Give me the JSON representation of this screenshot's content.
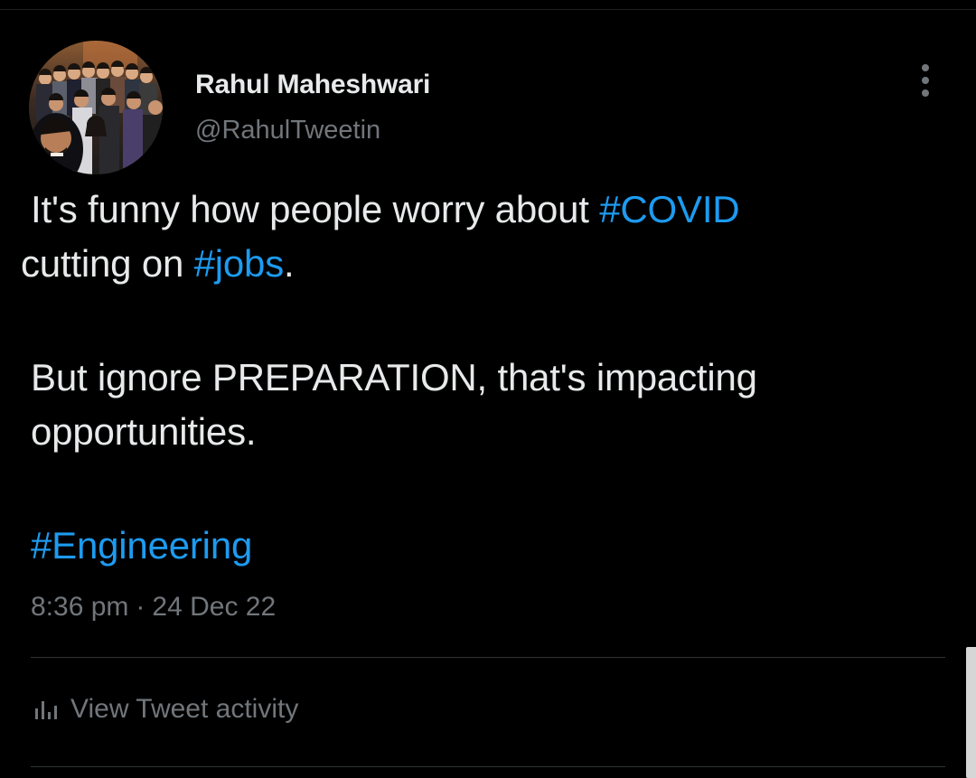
{
  "author": {
    "display_name": "Rahul Maheshwari",
    "handle": "@RahulTweetin"
  },
  "tweet": {
    "paragraph_1": [
      {
        "text": "It's funny how people worry about ",
        "hashtag": false
      },
      {
        "text": "#COVID",
        "hashtag": true
      },
      {
        "text": " cutting on ",
        "hashtag": false
      },
      {
        "text": "#jobs",
        "hashtag": true
      },
      {
        "text": ".",
        "hashtag": false
      }
    ],
    "paragraph_2": [
      {
        "text": "But ignore PREPARATION, that's impacting opportunities.",
        "hashtag": false
      }
    ],
    "paragraph_3": [
      {
        "text": "#Engineering",
        "hashtag": true
      }
    ]
  },
  "meta": {
    "time": "8:36 pm",
    "separator": "·",
    "date": "24 Dec 22"
  },
  "actions": {
    "view_activity_label": "View Tweet activity",
    "more_icon": "more-vertical-icon",
    "activity_icon": "bar-chart-icon"
  },
  "colors": {
    "background": "#000000",
    "text_primary": "#e7e9ea",
    "text_secondary": "#71767b",
    "hashtag": "#1d9bf0",
    "divider": "#2f3336"
  }
}
